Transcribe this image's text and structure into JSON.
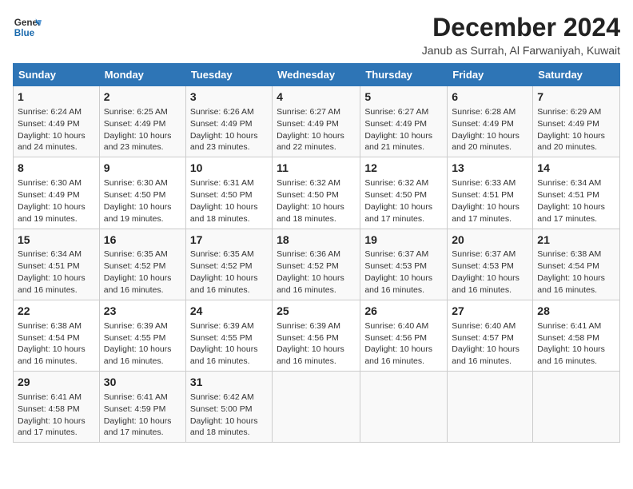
{
  "header": {
    "logo_line1": "General",
    "logo_line2": "Blue",
    "month_title": "December 2024",
    "location": "Janub as Surrah, Al Farwaniyah, Kuwait"
  },
  "days_of_week": [
    "Sunday",
    "Monday",
    "Tuesday",
    "Wednesday",
    "Thursday",
    "Friday",
    "Saturday"
  ],
  "weeks": [
    [
      {
        "day": "1",
        "info": "Sunrise: 6:24 AM\nSunset: 4:49 PM\nDaylight: 10 hours and 24 minutes."
      },
      {
        "day": "2",
        "info": "Sunrise: 6:25 AM\nSunset: 4:49 PM\nDaylight: 10 hours and 23 minutes."
      },
      {
        "day": "3",
        "info": "Sunrise: 6:26 AM\nSunset: 4:49 PM\nDaylight: 10 hours and 23 minutes."
      },
      {
        "day": "4",
        "info": "Sunrise: 6:27 AM\nSunset: 4:49 PM\nDaylight: 10 hours and 22 minutes."
      },
      {
        "day": "5",
        "info": "Sunrise: 6:27 AM\nSunset: 4:49 PM\nDaylight: 10 hours and 21 minutes."
      },
      {
        "day": "6",
        "info": "Sunrise: 6:28 AM\nSunset: 4:49 PM\nDaylight: 10 hours and 20 minutes."
      },
      {
        "day": "7",
        "info": "Sunrise: 6:29 AM\nSunset: 4:49 PM\nDaylight: 10 hours and 20 minutes."
      }
    ],
    [
      {
        "day": "8",
        "info": "Sunrise: 6:30 AM\nSunset: 4:49 PM\nDaylight: 10 hours and 19 minutes."
      },
      {
        "day": "9",
        "info": "Sunrise: 6:30 AM\nSunset: 4:50 PM\nDaylight: 10 hours and 19 minutes."
      },
      {
        "day": "10",
        "info": "Sunrise: 6:31 AM\nSunset: 4:50 PM\nDaylight: 10 hours and 18 minutes."
      },
      {
        "day": "11",
        "info": "Sunrise: 6:32 AM\nSunset: 4:50 PM\nDaylight: 10 hours and 18 minutes."
      },
      {
        "day": "12",
        "info": "Sunrise: 6:32 AM\nSunset: 4:50 PM\nDaylight: 10 hours and 17 minutes."
      },
      {
        "day": "13",
        "info": "Sunrise: 6:33 AM\nSunset: 4:51 PM\nDaylight: 10 hours and 17 minutes."
      },
      {
        "day": "14",
        "info": "Sunrise: 6:34 AM\nSunset: 4:51 PM\nDaylight: 10 hours and 17 minutes."
      }
    ],
    [
      {
        "day": "15",
        "info": "Sunrise: 6:34 AM\nSunset: 4:51 PM\nDaylight: 10 hours and 16 minutes."
      },
      {
        "day": "16",
        "info": "Sunrise: 6:35 AM\nSunset: 4:52 PM\nDaylight: 10 hours and 16 minutes."
      },
      {
        "day": "17",
        "info": "Sunrise: 6:35 AM\nSunset: 4:52 PM\nDaylight: 10 hours and 16 minutes."
      },
      {
        "day": "18",
        "info": "Sunrise: 6:36 AM\nSunset: 4:52 PM\nDaylight: 10 hours and 16 minutes."
      },
      {
        "day": "19",
        "info": "Sunrise: 6:37 AM\nSunset: 4:53 PM\nDaylight: 10 hours and 16 minutes."
      },
      {
        "day": "20",
        "info": "Sunrise: 6:37 AM\nSunset: 4:53 PM\nDaylight: 10 hours and 16 minutes."
      },
      {
        "day": "21",
        "info": "Sunrise: 6:38 AM\nSunset: 4:54 PM\nDaylight: 10 hours and 16 minutes."
      }
    ],
    [
      {
        "day": "22",
        "info": "Sunrise: 6:38 AM\nSunset: 4:54 PM\nDaylight: 10 hours and 16 minutes."
      },
      {
        "day": "23",
        "info": "Sunrise: 6:39 AM\nSunset: 4:55 PM\nDaylight: 10 hours and 16 minutes."
      },
      {
        "day": "24",
        "info": "Sunrise: 6:39 AM\nSunset: 4:55 PM\nDaylight: 10 hours and 16 minutes."
      },
      {
        "day": "25",
        "info": "Sunrise: 6:39 AM\nSunset: 4:56 PM\nDaylight: 10 hours and 16 minutes."
      },
      {
        "day": "26",
        "info": "Sunrise: 6:40 AM\nSunset: 4:56 PM\nDaylight: 10 hours and 16 minutes."
      },
      {
        "day": "27",
        "info": "Sunrise: 6:40 AM\nSunset: 4:57 PM\nDaylight: 10 hours and 16 minutes."
      },
      {
        "day": "28",
        "info": "Sunrise: 6:41 AM\nSunset: 4:58 PM\nDaylight: 10 hours and 16 minutes."
      }
    ],
    [
      {
        "day": "29",
        "info": "Sunrise: 6:41 AM\nSunset: 4:58 PM\nDaylight: 10 hours and 17 minutes."
      },
      {
        "day": "30",
        "info": "Sunrise: 6:41 AM\nSunset: 4:59 PM\nDaylight: 10 hours and 17 minutes."
      },
      {
        "day": "31",
        "info": "Sunrise: 6:42 AM\nSunset: 5:00 PM\nDaylight: 10 hours and 18 minutes."
      },
      null,
      null,
      null,
      null
    ]
  ]
}
